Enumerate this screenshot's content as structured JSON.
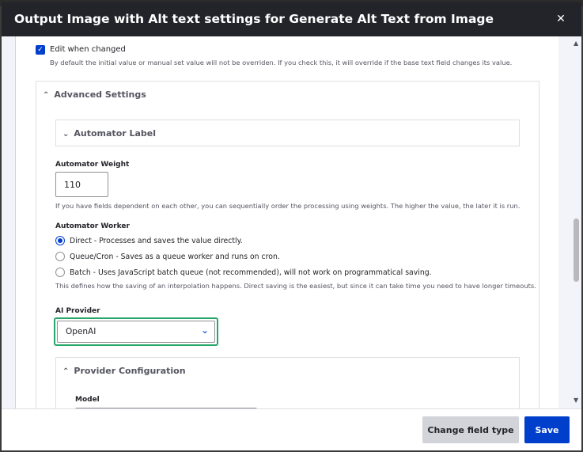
{
  "dialog": {
    "title": "Output Image with Alt text settings for Generate Alt Text from Image",
    "close_icon": "close-icon"
  },
  "edit_when_changed": {
    "checked": true,
    "label": "Edit when changed",
    "description": "By default the initial value or manual set value will not be overriden. If you check this, it will override if the base text field changes its value."
  },
  "advanced": {
    "heading": "Advanced Settings",
    "automator_label_heading": "Automator Label",
    "weight": {
      "label": "Automator Weight",
      "value": "110",
      "description": "If you have fields dependent on each other, you can sequentially order the processing using weights. The higher the value, the later it is run."
    },
    "worker": {
      "label": "Automator Worker",
      "options": [
        {
          "label": "Direct - Processes and saves the value directly.",
          "checked": true
        },
        {
          "label": "Queue/Cron - Saves as a queue worker and runs on cron.",
          "checked": false
        },
        {
          "label": "Batch - Uses JavaScript batch queue (not recommended), will not work on programmatical saving.",
          "checked": false
        }
      ],
      "description": "This defines how the saving of an interpolation happens. Direct saving is the easiest, but since it can take time you need to have longer timeouts."
    },
    "ai_provider": {
      "label": "AI Provider",
      "selected": "OpenAI"
    },
    "provider_config": {
      "heading": "Provider Configuration",
      "model_label": "Model"
    }
  },
  "footer": {
    "change_field_type": "Change field type",
    "save": "Save"
  },
  "colors": {
    "primary": "#003ecc",
    "titlebar": "#232429",
    "focus": "#26a769"
  }
}
